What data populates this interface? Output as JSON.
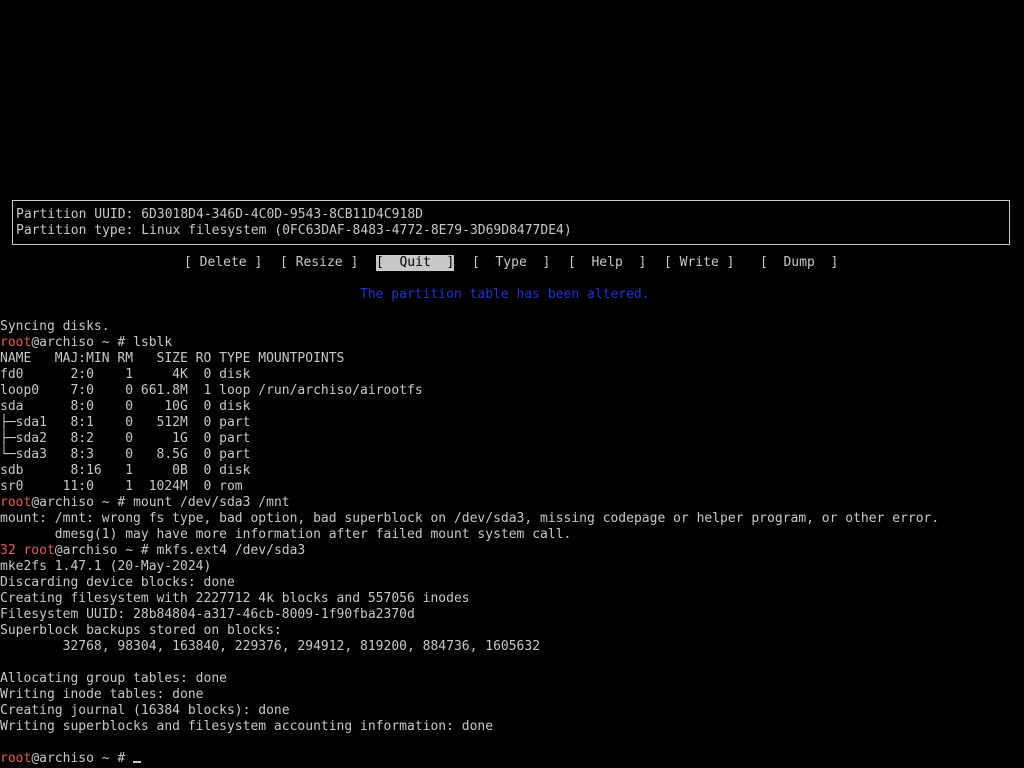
{
  "cfdisk": {
    "partition_uuid": "Partition UUID: 6D3018D4-346D-4C0D-9543-8CB11D4C918D",
    "partition_type": "Partition type: Linux filesystem (0FC63DAF-8483-4772-8E79-3D69D8477DE4)",
    "menu": {
      "delete": "[ Delete ]",
      "resize": "[ Resize ]",
      "quit": "[  Quit  ]",
      "type": "[  Type  ]",
      "help": "[  Help  ]",
      "write": "[ Write ]",
      "dump": "[  Dump  ]"
    },
    "status": "The partition table has been altered."
  },
  "terminal": {
    "prompt_user": "root",
    "prompt_host": "@archiso ~ # ",
    "exit_code": "32 ",
    "l01": "Syncing disks.",
    "cmd_lsblk": "lsblk",
    "l03": "NAME   MAJ:MIN RM   SIZE RO TYPE MOUNTPOINTS",
    "l04": "fd0      2:0    1     4K  0 disk",
    "l05": "loop0    7:0    0 661.8M  1 loop /run/archiso/airootfs",
    "l06": "sda      8:0    0    10G  0 disk",
    "l07": "├─sda1   8:1    0   512M  0 part",
    "l08": "├─sda2   8:2    0     1G  0 part",
    "l09": "└─sda3   8:3    0   8.5G  0 part",
    "l10": "sdb      8:16   1     0B  0 disk",
    "l11": "sr0     11:0    1  1024M  0 rom",
    "cmd_mount": "mount /dev/sda3 /mnt",
    "l13": "mount: /mnt: wrong fs type, bad option, bad superblock on /dev/sda3, missing codepage or helper program, or other error.",
    "l14": "       dmesg(1) may have more information after failed mount system call.",
    "cmd_mkfs": "mkfs.ext4 /dev/sda3",
    "l16": "mke2fs 1.47.1 (20-May-2024)",
    "l17": "Discarding device blocks: done",
    "l18": "Creating filesystem with 2227712 4k blocks and 557056 inodes",
    "l19": "Filesystem UUID: 28b84804-a317-46cb-8009-1f90fba2370d",
    "l20": "Superblock backups stored on blocks:",
    "l21": "        32768, 98304, 163840, 229376, 294912, 819200, 884736, 1605632",
    "l23": "Allocating group tables: done",
    "l24": "Writing inode tables: done",
    "l25": "Creating journal (16384 blocks): done",
    "l26": "Writing superblocks and filesystem accounting information: done"
  }
}
